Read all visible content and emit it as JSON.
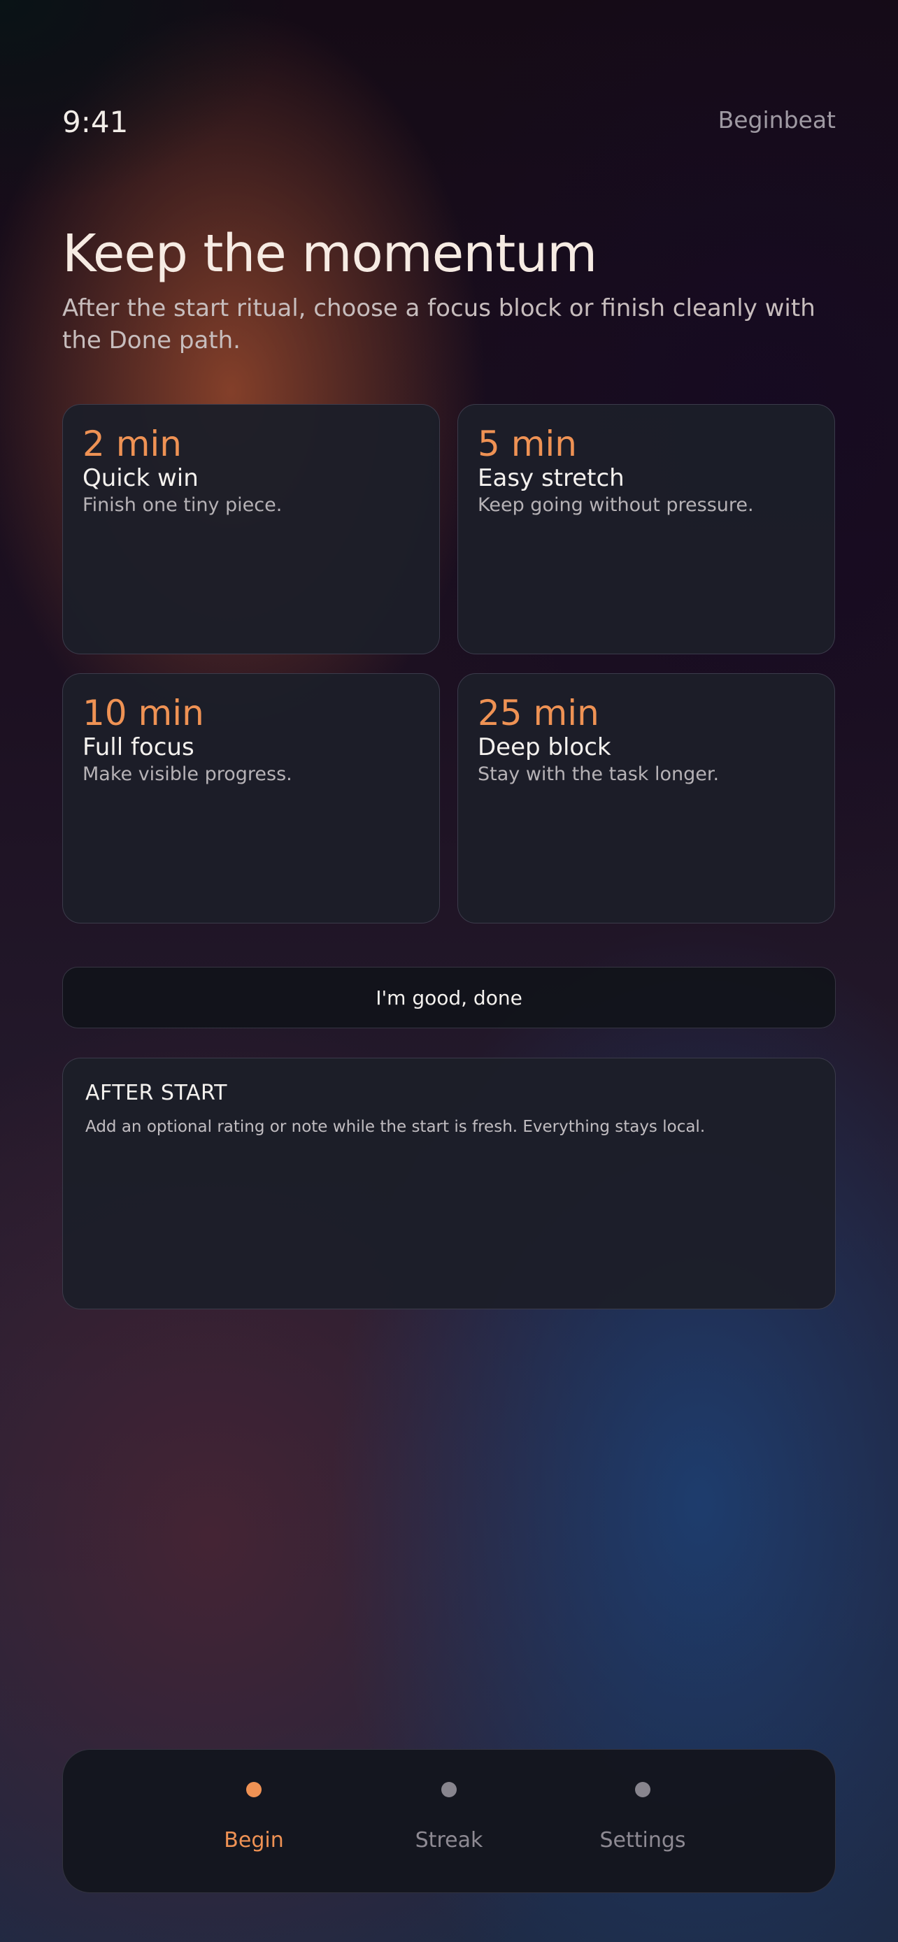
{
  "status_bar": {
    "time": "9:41",
    "app_name": "Beginbeat"
  },
  "header": {
    "title": "Keep the momentum",
    "subtitle": "After the start ritual, choose a focus block or finish cleanly with the Done path."
  },
  "focus_options": [
    {
      "duration": "2 min",
      "name": "Quick win",
      "description": "Finish one tiny piece."
    },
    {
      "duration": "5 min",
      "name": "Easy stretch",
      "description": "Keep going without pressure."
    },
    {
      "duration": "10 min",
      "name": "Full focus",
      "description": "Make visible progress."
    },
    {
      "duration": "25 min",
      "name": "Deep block",
      "description": "Stay with the task longer."
    }
  ],
  "done_button": {
    "label": "I'm good, done"
  },
  "after_start": {
    "heading": "AFTER START",
    "text": "Add an optional rating or note while the start is fresh. Everything stays local."
  },
  "tabbar": {
    "tabs": [
      {
        "label": "Begin",
        "active": true
      },
      {
        "label": "Streak",
        "active": false
      },
      {
        "label": "Settings",
        "active": false
      }
    ]
  },
  "colors": {
    "accent": "#ef9254",
    "card_bg": "#1c1e29",
    "text_primary": "#f4f1ee",
    "text_muted": "#b6b2b6"
  }
}
